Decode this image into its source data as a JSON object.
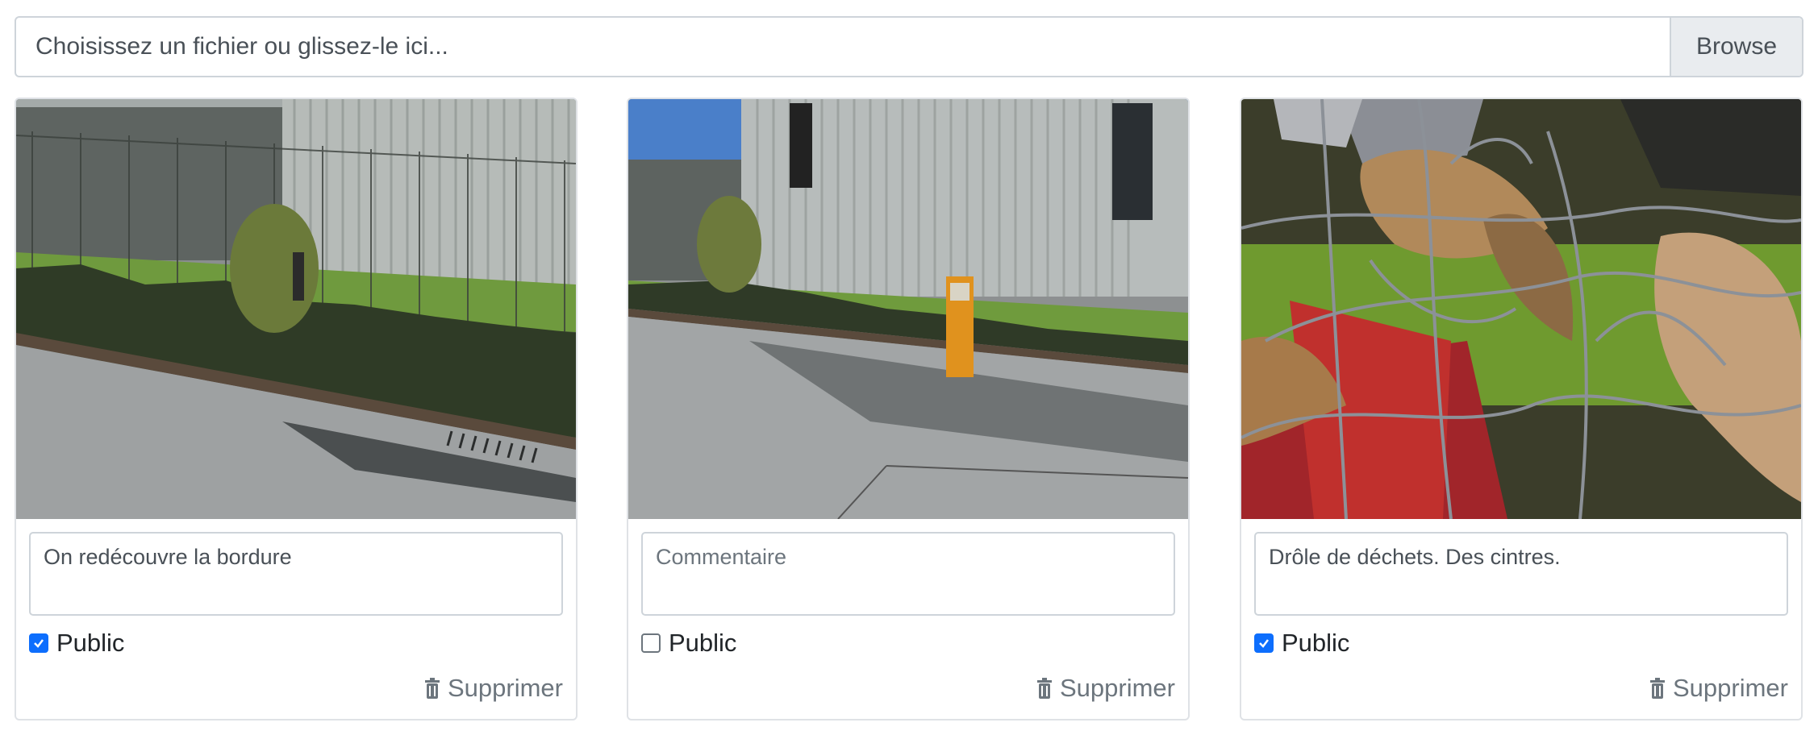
{
  "file_input": {
    "label": "Choisissez un fichier ou glissez-le ici...",
    "browse_label": "Browse"
  },
  "cards": [
    {
      "comment": "On redécouvre la bordure",
      "comment_placeholder": "Commentaire",
      "public_label": "Public",
      "public_checked": true,
      "delete_label": "Supprimer",
      "photo_subject": "fence-and-hedge-street"
    },
    {
      "comment": "",
      "comment_placeholder": "Commentaire",
      "public_label": "Public",
      "public_checked": false,
      "delete_label": "Supprimer",
      "photo_subject": "building-with-orange-post"
    },
    {
      "comment": "Drôle de déchets. Des cintres.",
      "comment_placeholder": "Commentaire",
      "public_label": "Public",
      "public_checked": true,
      "delete_label": "Supprimer",
      "photo_subject": "wire-hangers-and-leaves"
    }
  ],
  "colors": {
    "checkbox_checked": "#0d6efd",
    "muted_text": "#6c757d",
    "browse_bg": "#e9ecef"
  }
}
